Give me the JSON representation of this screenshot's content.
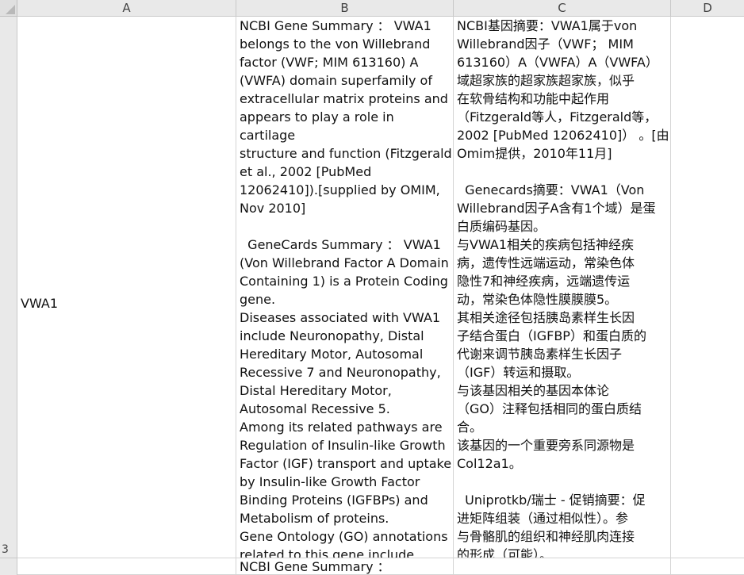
{
  "columns": [
    "A",
    "B",
    "C",
    "D"
  ],
  "rows": [
    {
      "number": "3"
    }
  ],
  "cells": {
    "a3": "VWA1",
    "b3": "NCBI Gene Summary ： VWA1\nbelongs to the von Willebrand\nfactor (VWF; MIM 613160) A\n(VWFA) domain superfamily of\nextracellular matrix proteins and\nappears to play a role in cartilage\nstructure and function (Fitzgerald\net al., 2002 [PubMed\n12062410]).[supplied by OMIM,\nNov 2010]\n\n  GeneCards Summary ： VWA1\n(Von Willebrand Factor A Domain\nContaining 1) is a Protein Coding\ngene.\nDiseases associated with VWA1\ninclude Neuronopathy, Distal\nHereditary Motor, Autosomal\nRecessive 7 and Neuronopathy,\nDistal Hereditary Motor,\nAutosomal Recessive 5.\nAmong its related pathways are\nRegulation of Insulin-like Growth\nFactor (IGF) transport and uptake\nby Insulin-like Growth Factor\nBinding Proteins (IGFBPs) and\nMetabolism of proteins.\nGene Ontology (GO) annotations\nrelated to this gene include\nidentical protein binding.",
    "c3": "NCBI基因摘要：VWA1属于von\nWillebrand因子（VWF； MIM\n613160）A（VWFA）A（VWFA）\n域超家族的超家族超家族，似乎\n在软骨结构和功能中起作用\n（Fitzgerald等人，Fitzgerald等，\n2002 [PubMed 12062410]） 。[由\nOmim提供，2010年11月]\n\n  Genecards摘要：VWA1（Von\nWillebrand因子A含有1个域）是蛋\n白质编码基因。\n与VWA1相关的疾病包括神经疾\n病，遗传性远端运动，常染色体\n隐性7和神经疾病，远端遗传运\n动，常染色体隐性膜膜膜5。\n其相关途径包括胰岛素样生长因\n子结合蛋白（IGFBP）和蛋白质的\n代谢来调节胰岛素样生长因子\n（IGF）转运和摄取。\n与该基因相关的基因本体论\n（GO）注释包括相同的蛋白质结\n合。\n该基因的一个重要旁系同源物是\nCol12a1。\n\n  Uniprotkb/瑞士 - 促销摘要：促\n进矩阵组装（通过相似性）。参\n与骨骼肌的组织和神经肌肉连接\n的形成（可能）。",
    "b4": "NCBI Gene Summary ： Predicted"
  },
  "colors": {
    "header_bg": "#e9e9e9",
    "grid_line": "#d4d4d4"
  }
}
